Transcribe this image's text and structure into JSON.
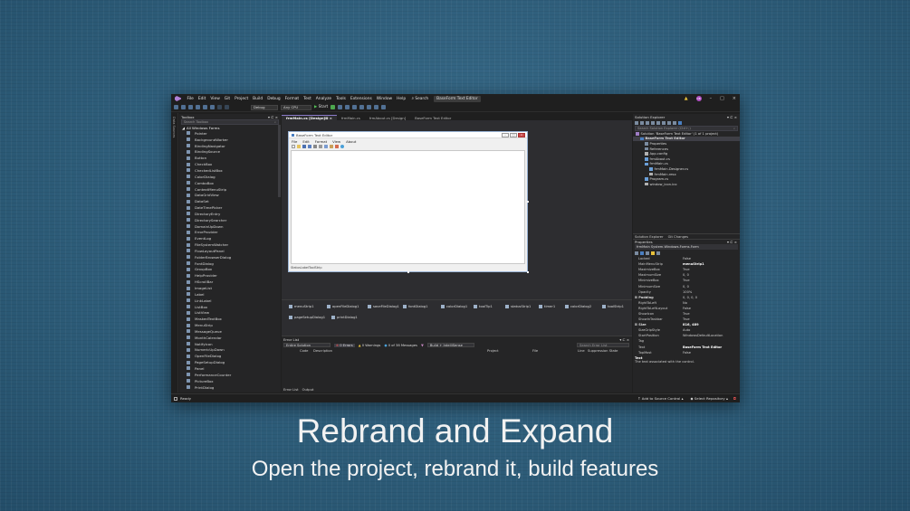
{
  "menubar": {
    "items": [
      "File",
      "Edit",
      "View",
      "Git",
      "Project",
      "Build",
      "Debug",
      "Format",
      "Test",
      "Analyze",
      "Tools",
      "Extensions",
      "Window",
      "Help"
    ],
    "search_label": "Search",
    "solution_title": "BaseForm Text Editor",
    "avatar_initials": "CB"
  },
  "toolbar": {
    "config": "Debug",
    "platform": "Any CPU",
    "start_label": "Start"
  },
  "side_strip": {
    "label": "Data Sources"
  },
  "toolbox": {
    "title": "Toolbox",
    "search_placeholder": "Search Toolbox",
    "group": "All Windows Forms",
    "items": [
      "Pointer",
      "BackgroundWorker",
      "BindingNavigator",
      "BindingSource",
      "Button",
      "CheckBox",
      "CheckedListBox",
      "ColorDialog",
      "ComboBox",
      "ContextMenuStrip",
      "DataGridView",
      "DataSet",
      "DateTimePicker",
      "DirectoryEntry",
      "DirectorySearcher",
      "DomainUpDown",
      "ErrorProvider",
      "EventLog",
      "FileSystemWatcher",
      "FlowLayoutPanel",
      "FolderBrowserDialog",
      "FontDialog",
      "GroupBox",
      "HelpProvider",
      "HScrollBar",
      "ImageList",
      "Label",
      "LinkLabel",
      "ListBox",
      "ListView",
      "MaskedTextBox",
      "MenuStrip",
      "MessageQueue",
      "MonthCalendar",
      "NotifyIcon",
      "NumericUpDown",
      "OpenFileDialog",
      "PageSetupDialog",
      "Panel",
      "PerformanceCounter",
      "PictureBox",
      "PrintDialog"
    ]
  },
  "tabs": [
    "frmMain.cs [Design]",
    "frmMain.cs",
    "frmAbout.cs [Design]",
    "BaseForm Text Editor"
  ],
  "form_preview": {
    "title": "BaseForm Text Editor",
    "menu": [
      "File",
      "Edit",
      "Format",
      "View",
      "About"
    ],
    "status": "StatusLabelToolStrip"
  },
  "component_tray": [
    {
      "label": "menuStrip1"
    },
    {
      "label": "openFileDialog1"
    },
    {
      "label": "saveFileDialog1"
    },
    {
      "label": "fontDialog1"
    },
    {
      "label": "colorDialog1"
    },
    {
      "label": "toolTip1"
    },
    {
      "label": "statusStrip1"
    },
    {
      "label": "timer1"
    },
    {
      "label": "colorDialog2"
    },
    {
      "label": "toolStrip1"
    },
    {
      "label": "pageSetupDialog1"
    },
    {
      "label": "printDialog1"
    }
  ],
  "error_list": {
    "title": "Error List",
    "scope": "Entire Solution",
    "errors": "0 Errors",
    "warnings": "0 Warnings",
    "messages": "0 of 38 Messages",
    "build_filter": "Build + IntelliSense",
    "search_placeholder": "Search Error List",
    "columns": [
      "Code",
      "Description",
      "Project",
      "File",
      "Line",
      "Suppression State"
    ],
    "bottom_tabs": [
      "Error List",
      "Output"
    ]
  },
  "solution_explorer": {
    "title": "Solution Explorer",
    "search_placeholder": "Search Solution Explorer (Ctrl+;)",
    "tree": [
      {
        "label": "Solution 'BaseForm Text Editor' (1 of 1 project)",
        "indent": 0
      },
      {
        "label": "BaseForm Text Editor",
        "indent": 1
      },
      {
        "label": "Properties",
        "indent": 2
      },
      {
        "label": "References",
        "indent": 2
      },
      {
        "label": "App.config",
        "indent": 2
      },
      {
        "label": "frmAbout.cs",
        "indent": 2
      },
      {
        "label": "frmMain.cs",
        "indent": 2
      },
      {
        "label": "frmMain.Designer.cs",
        "indent": 3
      },
      {
        "label": "frmMain.resx",
        "indent": 3
      },
      {
        "label": "Program.cs",
        "indent": 2
      },
      {
        "label": "window_icon.ico",
        "indent": 2
      }
    ],
    "bottom_tabs": [
      "Solution Explorer",
      "Git Changes"
    ]
  },
  "properties": {
    "title": "Properties",
    "object": "frmMain  System.Windows.Forms.Form",
    "rows": [
      {
        "name": "Locked",
        "value": "False"
      },
      {
        "name": "MainMenuStrip",
        "value": "menuStrip1",
        "bold": true
      },
      {
        "name": "MaximizeBox",
        "value": "True"
      },
      {
        "name": "MaximumSize",
        "value": "0, 0"
      },
      {
        "name": "MinimizeBox",
        "value": "True"
      },
      {
        "name": "MinimumSize",
        "value": "0, 0"
      },
      {
        "name": "Opacity",
        "value": "100%"
      },
      {
        "name": "Padding",
        "value": "0, 0, 0, 0",
        "group": true
      },
      {
        "name": "RightToLeft",
        "value": "No"
      },
      {
        "name": "RightToLeftLayout",
        "value": "False"
      },
      {
        "name": "ShowIcon",
        "value": "True"
      },
      {
        "name": "ShowInTaskbar",
        "value": "True"
      },
      {
        "name": "Size",
        "value": "816, 489",
        "group": true,
        "bold": true
      },
      {
        "name": "SizeGripStyle",
        "value": "Auto"
      },
      {
        "name": "StartPosition",
        "value": "WindowsDefaultLocation"
      },
      {
        "name": "Tag",
        "value": ""
      },
      {
        "name": "Text",
        "value": "BaseForm Text Editor",
        "bold": true
      },
      {
        "name": "TopMost",
        "value": "False"
      }
    ],
    "desc_title": "Text",
    "desc_body": "The text associated with the control."
  },
  "statusbar": {
    "ready": "Ready",
    "source_control": "Add to Source Control",
    "repository": "Select Repository"
  },
  "slide": {
    "title": "Rebrand and Expand",
    "subtitle": "Open the project, rebrand it, build features"
  }
}
